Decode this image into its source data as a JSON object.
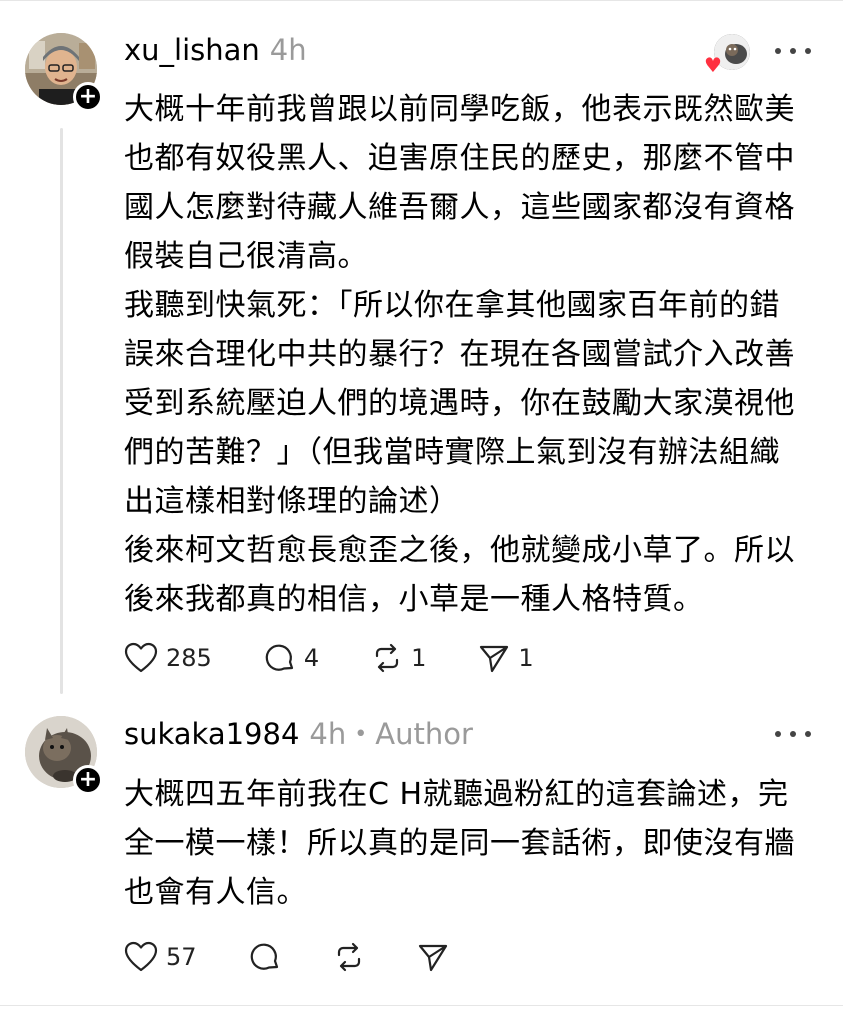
{
  "posts": [
    {
      "username": "xu_lishan",
      "time": "4h",
      "author_badge": "",
      "paragraphs": [
        "大概十年前我曾跟以前同學吃飯，他表示既然歐美\n也都有奴役黑人、迫害原住民的歷史，那麼不管中\n國人怎麼對待藏人維吾爾人，這些國家都沒有資格\n假裝自己很清高。\n我聽到快氣死：「所以你在拿其他國家百年前的錯\n誤來合理化中共的暴行？在現在各國嘗試介入改善\n受到系統壓迫人們的境遇時，你在鼓勵大家漠視他\n們的苦難？」（但我當時實際上氣到沒有辦法組織\n出這樣相對條理的論述）\n後來柯文哲愈長愈歪之後，他就變成小草了。所以\n後來我都真的相信，小草是一種人格特質。"
      ],
      "likes": "285",
      "comments": "4",
      "reposts": "1",
      "shares": "1"
    },
    {
      "username": "sukaka1984",
      "time": "4h",
      "author_badge": "Author",
      "paragraphs": [
        "大概四五年前我在C H就聽過粉紅的這套論述，完\n全一模一樣！所以真的是同一套話術，即使沒有牆\n也會有人信。"
      ],
      "likes": "57",
      "comments": "",
      "reposts": "",
      "shares": ""
    }
  ],
  "icons": {
    "like": "heart-icon",
    "comment": "comment-bubble-icon",
    "repost": "repost-icon",
    "share": "send-icon",
    "more": "more-dots-icon",
    "follow": "plus-icon"
  },
  "colors": {
    "heart_badge": "#ff3040",
    "muted": "#9a9a9a"
  }
}
